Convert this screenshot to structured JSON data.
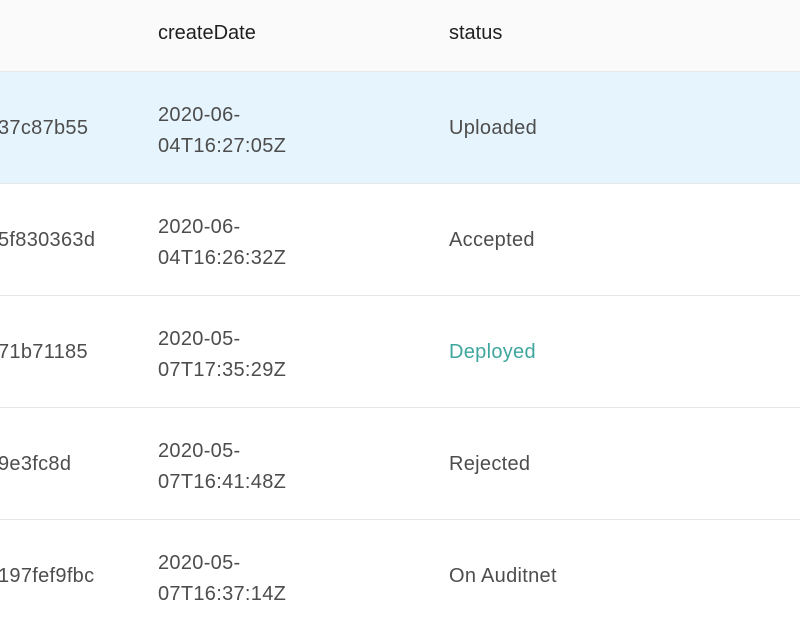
{
  "header": {
    "col_id": "",
    "col_date": "createDate",
    "col_status": "status"
  },
  "rows": [
    {
      "id": "37c87b55",
      "date_line1": "2020-06-",
      "date_line2": "04T16:27:05Z",
      "status": "Uploaded",
      "selected": true
    },
    {
      "id": "5f830363d",
      "date_line1": "2020-06-",
      "date_line2": "04T16:26:32Z",
      "status": "Accepted",
      "selected": false
    },
    {
      "id": "71b71185",
      "date_line1": "2020-05-",
      "date_line2": "07T17:35:29Z",
      "status": "Deployed",
      "selected": false,
      "status_is_link": true
    },
    {
      "id": "9e3fc8d",
      "date_line1": "2020-05-",
      "date_line2": "07T16:41:48Z",
      "status": "Rejected",
      "selected": false
    },
    {
      "id": "197fef9fbc",
      "date_line1": "2020-05-",
      "date_line2": "07T16:37:14Z",
      "status": "On Auditnet",
      "selected": false
    }
  ],
  "colors": {
    "selected_row_bg": "#e6f4fd",
    "link_status": "#3ea69e",
    "header_bg": "#fafafa"
  }
}
